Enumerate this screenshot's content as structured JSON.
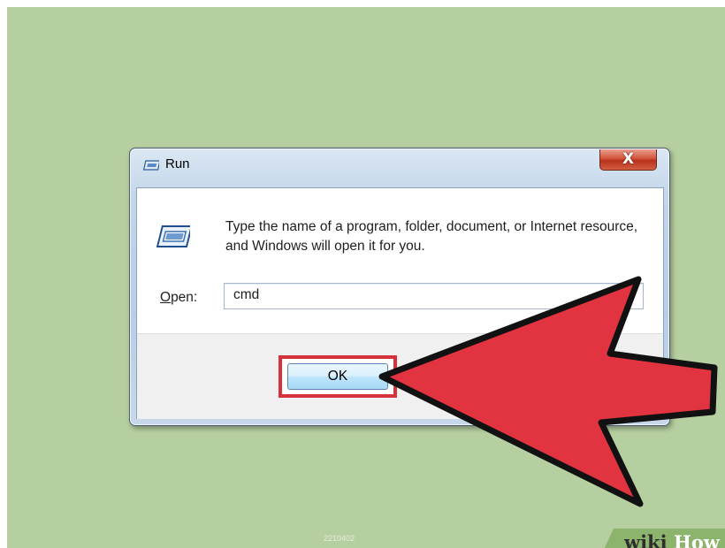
{
  "dialog": {
    "title": "Run",
    "close_glyph": "X",
    "description": "Type the name of a program, folder, document, or Internet resource, and Windows will open it for you.",
    "open_label_mnemonic": "O",
    "open_label_rest": "pen:",
    "open_value": "cmd",
    "ok_label": "OK"
  },
  "icons": {
    "title_icon": "run-window-icon",
    "main_icon": "run-window-icon"
  },
  "annotation": {
    "highlight_color": "#d5323c",
    "arrow_color": "#e23340"
  },
  "branding": {
    "wiki": "wiki",
    "how": "How",
    "watermark": "2210402"
  }
}
